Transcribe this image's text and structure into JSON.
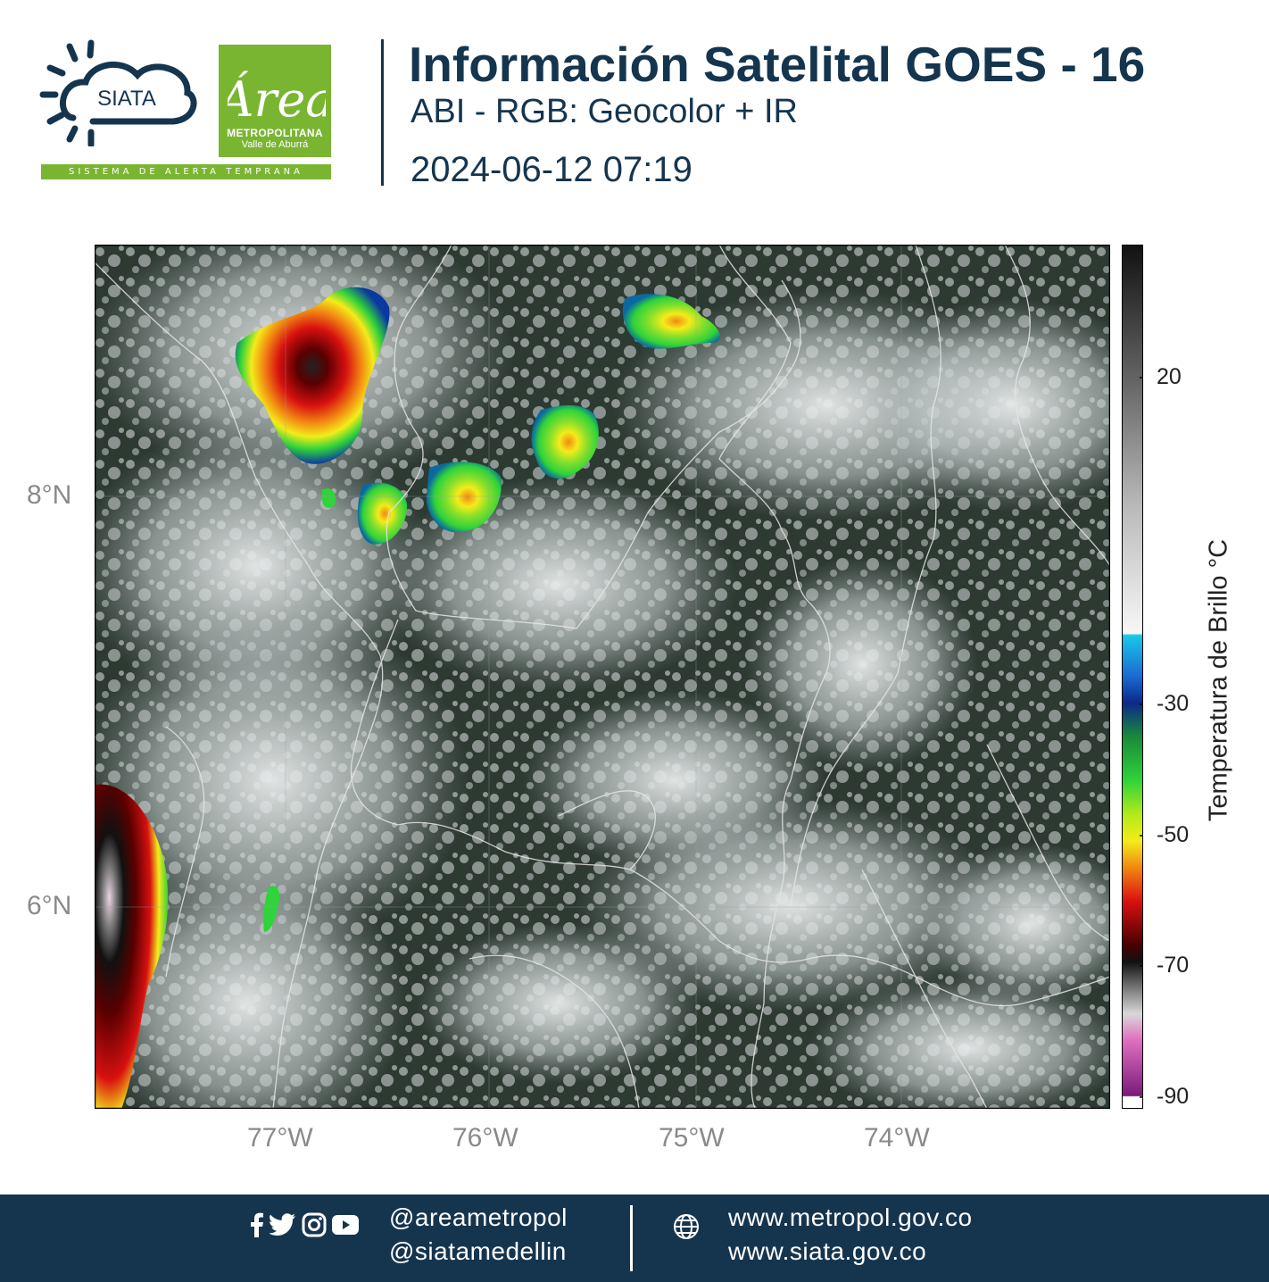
{
  "header": {
    "siata_logo_text": "SIATA",
    "siata_banner": "SISTEMA DE ALERTA TEMPRANA",
    "area_logo_script": "Área",
    "area_logo_line1": "METROPOLITANA",
    "area_logo_line2": "Valle de Aburrá",
    "title": "Información Satelital GOES - 16",
    "subtitle": "ABI - RGB: Geocolor + IR",
    "datetime": "2024-06-12 07:19"
  },
  "map": {
    "lat_labels": [
      "8°N",
      "6°N"
    ],
    "lon_labels": [
      "77°W",
      "76°W",
      "75°W",
      "74°W"
    ],
    "colorbar": {
      "label": "Temperatura de Brillo °C",
      "ticks": [
        "20",
        "-30",
        "-50",
        "-70",
        "-90"
      ],
      "colors": {
        "warm_top": "#111111",
        "gray": "#9a9a9a",
        "white": "#f7f7f7",
        "cyan": "#18c8ea",
        "blue": "#0a3aa0",
        "green": "#2fd33a",
        "yellow": "#f3ec1a",
        "orange": "#f28a12",
        "red": "#d81010",
        "dark_red": "#4a0000",
        "magenta": "#e070c0",
        "purple": "#7a1a7a"
      }
    }
  },
  "footer": {
    "social_icons": [
      "facebook-icon",
      "twitter-icon",
      "instagram-icon",
      "youtube-icon"
    ],
    "handle1": "@areametropol",
    "handle2": "@siatamedellin",
    "web1": "www.metropol.gov.co",
    "web2": "www.siata.gov.co"
  }
}
